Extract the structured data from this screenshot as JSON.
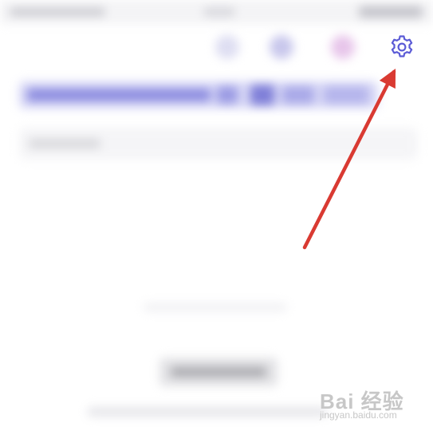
{
  "screen": {
    "content_state": "blurred"
  },
  "toolbar": {
    "settings_icon": "gear-icon",
    "accent_color": "#5b5bd6"
  },
  "annotation": {
    "type": "arrow",
    "color": "#d93a32",
    "points_to": "gear-icon"
  },
  "watermark": {
    "logo_text": "Bai 经验",
    "url_text": "jingyan.baidu.com"
  }
}
